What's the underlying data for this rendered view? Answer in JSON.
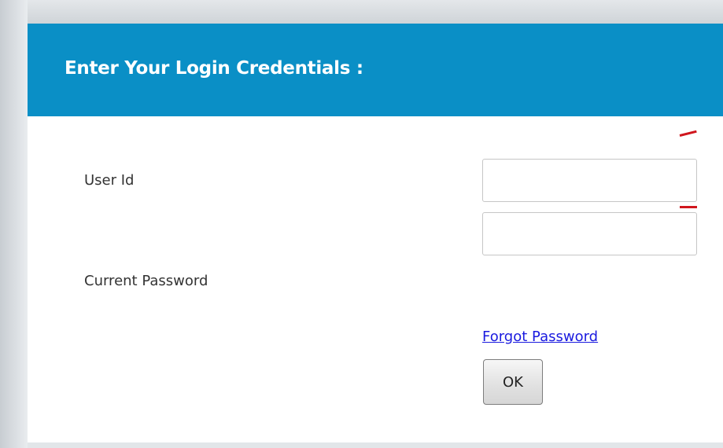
{
  "header": {
    "title": "Enter Your Login Credentials :"
  },
  "form": {
    "user_id_label": "User Id",
    "user_id_value": "",
    "password_label": "Current Password",
    "password_value": "",
    "forgot_link": "Forgot Password",
    "ok_button": "OK"
  },
  "colors": {
    "header_bg": "#0a8fc6",
    "link": "#1a1adf",
    "annotation_marker": "#d0161d"
  }
}
